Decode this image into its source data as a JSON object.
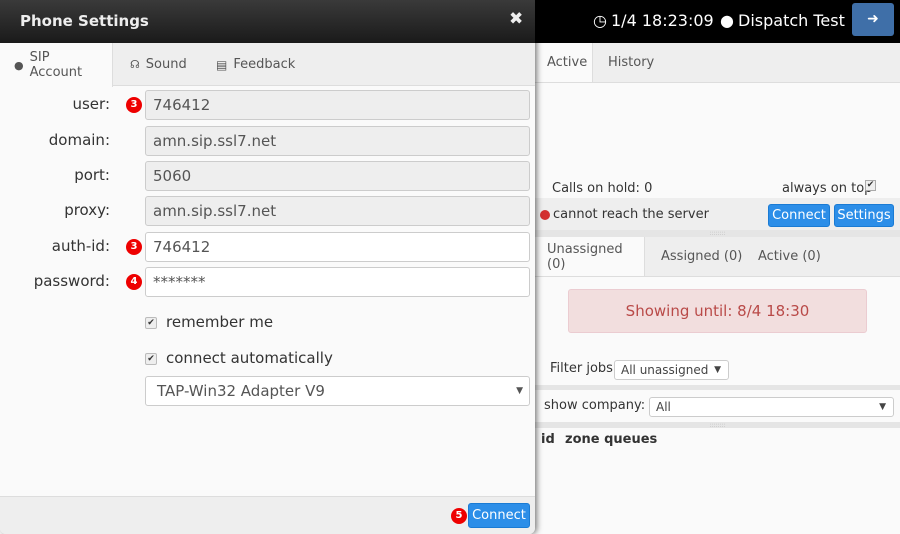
{
  "topbar": {
    "clock": "1/4 18:23:09",
    "user": "Dispatch Test",
    "clock_icon": "clock-icon",
    "user_icon": "user-icon",
    "logout_icon": "sign-out-icon"
  },
  "main_tabs": [
    "Active",
    "History"
  ],
  "calls_on_hold": "Calls on hold: 0",
  "always_on_top": {
    "label": "always on top",
    "checked": true
  },
  "status": {
    "text": "cannot reach the server",
    "color": "#d32f2f"
  },
  "buttons": {
    "connect": "Connect",
    "settings": "Settings"
  },
  "job_tabs": [
    "Unassigned (0)",
    "Assigned (0)",
    "Active (0)"
  ],
  "alert": "Showing until: 8/4 18:30",
  "filter": {
    "label": "Filter jobs:",
    "value": "All unassigned"
  },
  "company": {
    "label": "show company:",
    "value": "All"
  },
  "table_headers": [
    "id",
    "zone queues"
  ],
  "dialog": {
    "title": "Phone Settings",
    "close_icon": "close-icon",
    "tabs": [
      "SIP Account",
      "Sound",
      "Feedback"
    ],
    "fields": [
      {
        "label": "user:",
        "value": "746412",
        "readonly": true,
        "badge": "3"
      },
      {
        "label": "domain:",
        "value": "amn.sip.ssl7.net",
        "readonly": true,
        "badge": ""
      },
      {
        "label": "port:",
        "value": "5060",
        "readonly": true,
        "badge": ""
      },
      {
        "label": "proxy:",
        "value": "amn.sip.ssl7.net",
        "readonly": true,
        "badge": ""
      },
      {
        "label": "auth-id:",
        "value": "746412",
        "readonly": false,
        "badge": "3"
      },
      {
        "label": "password:",
        "value": "*******",
        "readonly": false,
        "badge": "4"
      }
    ],
    "remember_me": {
      "label": "remember me",
      "checked": true
    },
    "connect_auto": {
      "label": "connect automatically",
      "checked": true
    },
    "adapter": "TAP-Win32 Adapter V9",
    "connect_badge": "5",
    "connect_button": "Connect"
  },
  "colors": {
    "primary": "#2c8ee8",
    "badge": "#e00000",
    "alert_bg": "#f2dede",
    "alert_text": "#b94a48"
  }
}
